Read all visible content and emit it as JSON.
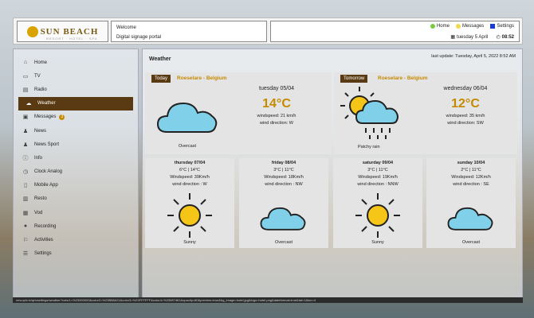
{
  "header": {
    "logo_text": "SUN BEACH",
    "logo_sub": "RESORT · HOTEL · SPA",
    "welcome": "Welcome",
    "portal": "Digital signage portal",
    "legend": [
      {
        "label": "Home",
        "color": "#7ac943"
      },
      {
        "label": "Messages",
        "color": "#f2d94e"
      },
      {
        "label": "Settings",
        "color": "#1c3bd6"
      }
    ],
    "date": "tuesday 5 April",
    "time": "08:52"
  },
  "sidebar": {
    "items": [
      {
        "label": "Home",
        "icon": "home-icon",
        "glyph": "⌂"
      },
      {
        "label": "TV",
        "icon": "tv-icon",
        "glyph": "▭"
      },
      {
        "label": "Radio",
        "icon": "radio-icon",
        "glyph": "▤"
      },
      {
        "label": "Weather",
        "icon": "cloud-icon",
        "glyph": "☁"
      },
      {
        "label": "Messages",
        "icon": "messages-icon",
        "glyph": "▣",
        "badge": "3"
      },
      {
        "label": "News",
        "icon": "news-icon",
        "glyph": "♟"
      },
      {
        "label": "News Sport",
        "icon": "sport-icon",
        "glyph": "♟"
      },
      {
        "label": "Info",
        "icon": "info-icon",
        "glyph": "ⓘ"
      },
      {
        "label": "Clock Analog",
        "icon": "clock-icon",
        "glyph": "◷"
      },
      {
        "label": "Mobile App",
        "icon": "mobile-icon",
        "glyph": "▯"
      },
      {
        "label": "Resto",
        "icon": "resto-icon",
        "glyph": "▥"
      },
      {
        "label": "Vod",
        "icon": "vod-icon",
        "glyph": "▦"
      },
      {
        "label": "Recording",
        "icon": "recording-icon",
        "glyph": "●"
      },
      {
        "label": "Activities",
        "icon": "activities-icon",
        "glyph": "⚐"
      },
      {
        "label": "Settings",
        "icon": "settings-icon",
        "glyph": "☰"
      }
    ],
    "active_index": 3
  },
  "main": {
    "title": "Weather",
    "last_update": "last update: Tuesday, April 5, 2022 8:52 AM",
    "today": {
      "tag": "Today",
      "location": "Roeselare - Belgium",
      "day": "tuesday 05/04",
      "temp": "14°C",
      "windspeed": "windspeed: 21 km/h",
      "winddir": "wind direction: W",
      "condition": "Overcast"
    },
    "tomorrow": {
      "tag": "Tomorrow",
      "location": "Roeselare - Belgium",
      "day": "wednesday 06/04",
      "temp": "12°C",
      "windspeed": "windspeed: 35 km/h",
      "winddir": "wind direction: SW",
      "condition": "Patchy rain"
    },
    "forecast": [
      {
        "day": "thursday 07/04",
        "range": "6°C | 14°C",
        "wind": "Windspeed: 39Km/h",
        "dir": "wind direction : W",
        "condition": "Sunny",
        "icon": "sun-icon"
      },
      {
        "day": "friday 08/04",
        "range": "3°C | 11°C",
        "wind": "Windspeed: 18Km/h",
        "dir": "wind direction : NW",
        "condition": "Overcast",
        "icon": "cloud-icon"
      },
      {
        "day": "saturday 09/04",
        "range": "3°C | 11°C",
        "wind": "Windspeed: 19Km/h",
        "dir": "wind direction : NNW",
        "condition": "Sunny",
        "icon": "sun-icon"
      },
      {
        "day": "sunday 10/04",
        "range": "2°C | 11°C",
        "wind": "Windspeed: 12Km/h",
        "dir": "wind direction : SE",
        "condition": "Overcast",
        "icon": "cloud-icon"
      }
    ]
  },
  "status_url": "new.qrtv.tv/qrtvsettings/weather?color1=%23000000&color2=%23B58A21&color3=%23FFFFFF&color4=%23087461&opacity=80&preview=true&bg_image=hotel.jpg&logo=hotel.png&dateformat=true&lat=1&lon=4"
}
